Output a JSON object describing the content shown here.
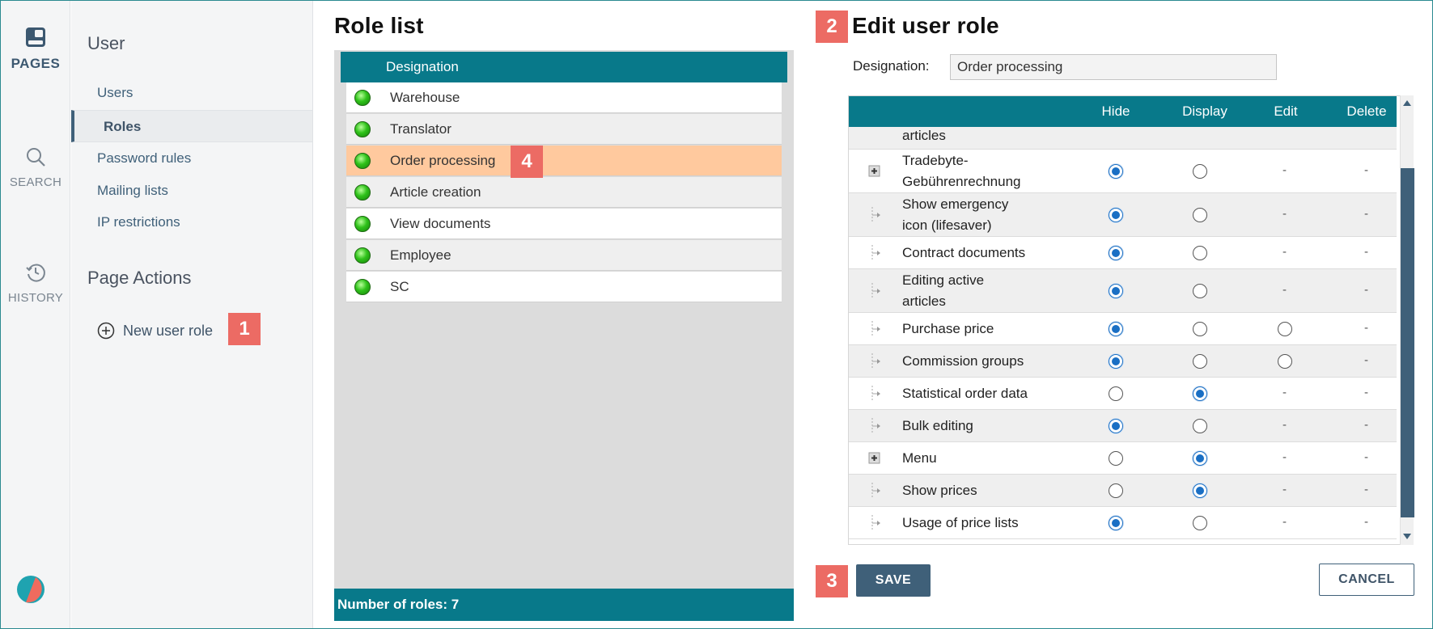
{
  "rail": {
    "pages_label": "PAGES",
    "search_label": "SEARCH",
    "history_label": "HISTORY",
    "accent": "#3c5870"
  },
  "sidebar": {
    "title": "User",
    "items": [
      {
        "label": "Users"
      },
      {
        "label": "Roles",
        "active": true
      },
      {
        "label": "Password rules"
      },
      {
        "label": "Mailing lists"
      },
      {
        "label": "IP restrictions"
      }
    ],
    "actions_title": "Page Actions",
    "new_role_label": "New user role"
  },
  "badges": [
    "1",
    "2",
    "3",
    "4"
  ],
  "role_list": {
    "title": "Role list",
    "column": "Designation",
    "rows": [
      {
        "name": "Warehouse"
      },
      {
        "name": "Translator"
      },
      {
        "name": "Order processing",
        "selected": true
      },
      {
        "name": "Article creation"
      },
      {
        "name": "View documents"
      },
      {
        "name": "Employee"
      },
      {
        "name": "SC"
      }
    ],
    "footer": "Number of roles: 7",
    "header_color": "#08798a",
    "selected_color": "#ffc99e"
  },
  "edit": {
    "title": "Edit user role",
    "designation_label": "Designation:",
    "designation_value": "Order processing",
    "columns": [
      "Hide",
      "Display",
      "Edit",
      "Delete"
    ],
    "rows": [
      {
        "name_lines": [
          "articles"
        ],
        "partial": true
      },
      {
        "name_lines": [
          "Tradebyte-",
          "Gebührenrechnung"
        ],
        "icon": "expand-icon",
        "hide": true,
        "display": false,
        "edit": "-",
        "delete": "-"
      },
      {
        "name_lines": [
          "Show emergency",
          "icon (lifesaver)"
        ],
        "icon": "tree-leaf-icon",
        "hide": true,
        "display": false,
        "edit": "-",
        "delete": "-"
      },
      {
        "name_lines": [
          "Contract documents"
        ],
        "icon": "tree-leaf-icon",
        "hide": true,
        "display": false,
        "edit": "-",
        "delete": "-"
      },
      {
        "name_lines": [
          "Editing active",
          "articles"
        ],
        "icon": "tree-leaf-icon",
        "hide": true,
        "display": false,
        "edit": "-",
        "delete": "-"
      },
      {
        "name_lines": [
          "Purchase price"
        ],
        "icon": "tree-leaf-icon",
        "hide": true,
        "display": false,
        "edit": "radio",
        "delete": "-"
      },
      {
        "name_lines": [
          "Commission groups"
        ],
        "icon": "tree-leaf-icon",
        "hide": true,
        "display": false,
        "edit": "radio",
        "delete": "-"
      },
      {
        "name_lines": [
          "Statistical order data"
        ],
        "icon": "tree-leaf-icon",
        "hide": false,
        "display": true,
        "edit": "-",
        "delete": "-"
      },
      {
        "name_lines": [
          "Bulk editing"
        ],
        "icon": "tree-leaf-icon",
        "hide": true,
        "display": false,
        "edit": "-",
        "delete": "-"
      },
      {
        "name_lines": [
          "Menu"
        ],
        "icon": "expand-icon",
        "hide": false,
        "display": true,
        "edit": "-",
        "delete": "-"
      },
      {
        "name_lines": [
          "Show prices"
        ],
        "icon": "tree-leaf-icon",
        "hide": false,
        "display": true,
        "edit": "-",
        "delete": "-"
      },
      {
        "name_lines": [
          "Usage of price lists"
        ],
        "icon": "tree-leaf-icon",
        "hide": true,
        "display": false,
        "edit": "-",
        "delete": "-"
      }
    ],
    "save_label": "SAVE",
    "cancel_label": "CANCEL"
  }
}
